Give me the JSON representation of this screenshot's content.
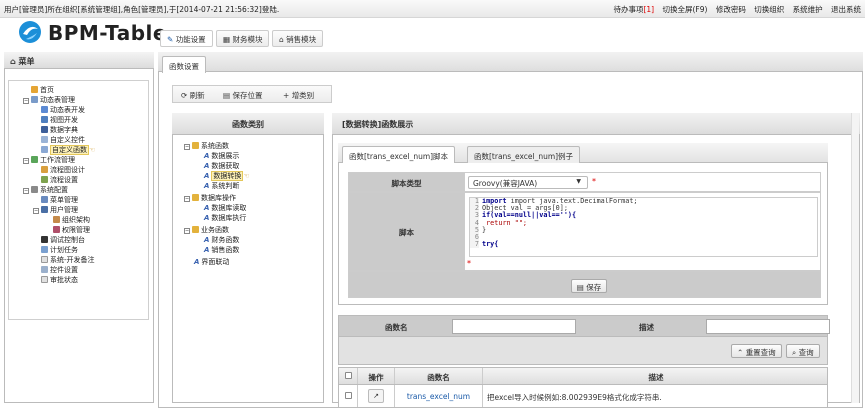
{
  "topbar": {
    "login_text": "用户[管理员]所在组织[系统管理组],角色[管理员],于[2014-07-21 21:56:32]登陆.",
    "todo_label": "待办事项",
    "todo_count": "[1]",
    "links": [
      "切换全屏(F9)",
      "修改密码",
      "切换组织",
      "系统维护",
      "退出系统"
    ]
  },
  "brand": {
    "name": "BPM-Table"
  },
  "main_tabs": [
    {
      "icon": "wrench-icon",
      "label": "功能设置"
    },
    {
      "icon": "grid-icon",
      "label": "财务模块"
    },
    {
      "icon": "home-icon",
      "label": "销售模块"
    }
  ],
  "menu": {
    "title": "菜单",
    "tree": [
      {
        "label": "首页"
      },
      {
        "label": "动态表管理"
      },
      {
        "label": "动态表开发"
      },
      {
        "label": "视图开发"
      },
      {
        "label": "数据字典"
      },
      {
        "label": "自定义控件"
      },
      {
        "label": "自定义函数"
      },
      {
        "label": "工作流管理"
      },
      {
        "label": "流程图设计"
      },
      {
        "label": "流程设置"
      },
      {
        "label": "系统配置"
      },
      {
        "label": "菜单管理"
      },
      {
        "label": "用户管理"
      },
      {
        "label": "组织架构"
      },
      {
        "label": "权限管理"
      },
      {
        "label": "调试控制台"
      },
      {
        "label": "计划任务"
      },
      {
        "label": "系统-开发备注"
      },
      {
        "label": "控件设置"
      },
      {
        "label": "审批状态"
      }
    ]
  },
  "content_tab": {
    "label": "函数设置"
  },
  "toolbar": {
    "refresh": "刷新",
    "save_position": "保存位置",
    "add_category": "增类别"
  },
  "category": {
    "title": "函数类别",
    "tree": [
      {
        "label": "系统函数"
      },
      {
        "label": "数据展示"
      },
      {
        "label": "数据获取"
      },
      {
        "label": "数据转换"
      },
      {
        "label": "系统判断"
      },
      {
        "label": "数据库操作"
      },
      {
        "label": "数据库读取"
      },
      {
        "label": "数据库执行"
      },
      {
        "label": "业务函数"
      },
      {
        "label": "财务函数"
      },
      {
        "label": "销售函数"
      },
      {
        "label": "界面联动"
      }
    ]
  },
  "display": {
    "title": "[数据转换]函数展示",
    "tabs": [
      "函数[trans_excel_num]脚本",
      "函数[trans_excel_num]例子"
    ],
    "script_type_label": "脚本类型",
    "script_type_value": "Groovy(兼容JAVA)",
    "script_label": "脚本",
    "code_lines": [
      "import java.text.DecimalFormat;",
      "Object val = args[0];",
      "if(val==null||val==''){",
      "  return \"\";",
      "}",
      "",
      "try{"
    ],
    "save_button": "保存"
  },
  "search": {
    "fn_name_label": "函数名",
    "desc_label": "描述",
    "reset_button": "重置查询",
    "query_button": "查询"
  },
  "grid": {
    "headers": [
      "操作",
      "函数名",
      "描述"
    ],
    "rows": [
      {
        "name": "trans_excel_num",
        "desc": "把excel导入时候例如:8.002939E9格式化成字符串."
      }
    ]
  },
  "colors": {
    "accent_blue": "#1a5aa8",
    "red": "#dd0000",
    "header_grey": "#cbcbcb"
  }
}
